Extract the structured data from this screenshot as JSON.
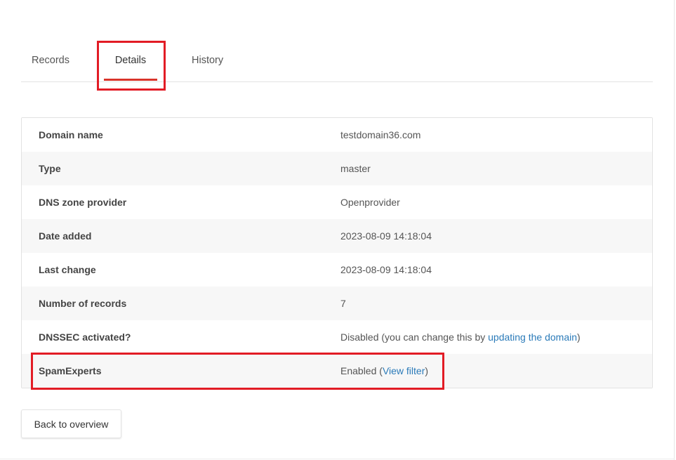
{
  "tabs": [
    {
      "label": "Records"
    },
    {
      "label": "Details"
    },
    {
      "label": "History"
    }
  ],
  "active_tab": "Details",
  "details": {
    "rows": [
      {
        "label": "Domain name",
        "value": "testdomain36.com"
      },
      {
        "label": "Type",
        "value": "master"
      },
      {
        "label": "DNS zone provider",
        "value": "Openprovider"
      },
      {
        "label": "Date added",
        "value": "2023-08-09 14:18:04"
      },
      {
        "label": "Last change",
        "value": "2023-08-09 14:18:04"
      },
      {
        "label": "Number of records",
        "value": "7"
      },
      {
        "label": "DNSSEC activated?",
        "value_prefix": "Disabled (you can change this by ",
        "link_text": "updating the domain",
        "value_suffix": ")"
      },
      {
        "label": "SpamExperts",
        "value_prefix": "Enabled (",
        "link_text": "View filter",
        "value_suffix": ")"
      }
    ]
  },
  "actions": {
    "back_label": "Back to overview"
  },
  "colors": {
    "accent": "#d9342b",
    "highlight": "#e21c25",
    "link": "#2b7bb9"
  }
}
